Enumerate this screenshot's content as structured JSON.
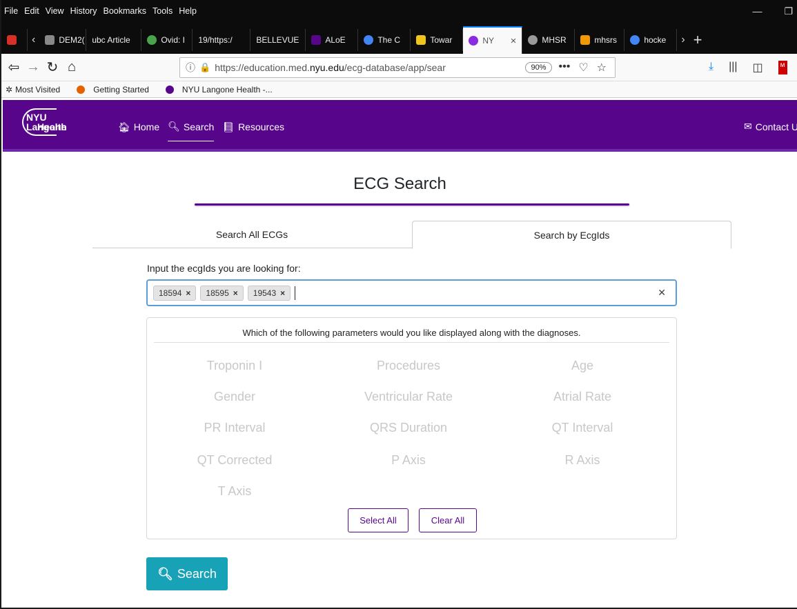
{
  "menu": [
    "File",
    "Edit",
    "View",
    "History",
    "Bookmarks",
    "Tools",
    "Help"
  ],
  "tabs": [
    {
      "label": "DEM2(",
      "color": "#888"
    },
    {
      "label": "ubc Article",
      "color": "#1b3a7a"
    },
    {
      "label": "Ovid: I",
      "color": "#4aa34a"
    },
    {
      "label": "19/https:/",
      "color": "#777"
    },
    {
      "label": "BELLEVUE",
      "color": "#777"
    },
    {
      "label": "ALoE",
      "color": "#57068c"
    },
    {
      "label": "The C",
      "color": "#4285f4"
    },
    {
      "label": "Towar",
      "color": "#f0c419"
    },
    {
      "label": "NY",
      "color": "#8a2be2"
    },
    {
      "label": "MHSR",
      "color": "#999"
    },
    {
      "label": "mhsrs",
      "color": "#f29900"
    },
    {
      "label": "hocke",
      "color": "#4285f4"
    }
  ],
  "tab_active_close": "×",
  "url": {
    "prefix": "https://education.med.",
    "domain": "nyu.edu",
    "rest": "/ecg-database/app/sear",
    "zoom": "90%"
  },
  "bookmarks": [
    "Most Visited",
    "Getting Started",
    "NYU Langone Health -..."
  ],
  "site": {
    "logo_line1": "NYU Langone",
    "logo_line2": "Health",
    "nav_home": "Home",
    "nav_search": "Search",
    "nav_resources": "Resources",
    "contact": "Contact U"
  },
  "main": {
    "title": "ECG Search",
    "tab_all": "Search All ECGs",
    "tab_ids": "Search by EcgIds",
    "input_label": "Input the ecgIds you are looking for:",
    "tags": [
      "18594",
      "18595",
      "19543"
    ],
    "params_title": "Which of the following parameters would you like displayed along with the diagnoses.",
    "params": [
      "Troponin I",
      "Procedures",
      "Age",
      "Gender",
      "Ventricular Rate",
      "Atrial Rate",
      "PR Interval",
      "QRS Duration",
      "QT Interval",
      "QT Corrected",
      "P Axis",
      "R Axis",
      "T Axis"
    ],
    "select_all": "Select All",
    "clear_all": "Clear All",
    "search_button": "Search"
  },
  "colors": {
    "brand": "#57068c",
    "search_button": "#17a2b8",
    "focus": "#5b9dd9"
  }
}
